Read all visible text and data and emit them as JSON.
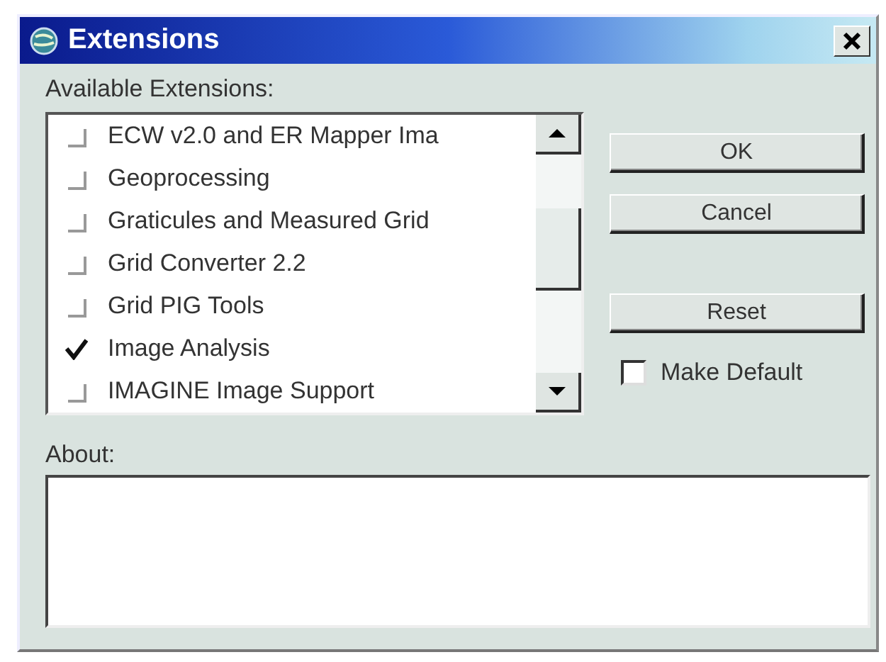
{
  "window": {
    "title": "Extensions"
  },
  "extensions": {
    "label": "Available Extensions:",
    "items": [
      {
        "label": "ECW v2.0 and ER Mapper Ima",
        "checked": false
      },
      {
        "label": "Geoprocessing",
        "checked": false
      },
      {
        "label": "Graticules and Measured Grid",
        "checked": false
      },
      {
        "label": "Grid Converter 2.2",
        "checked": false
      },
      {
        "label": "Grid PIG Tools",
        "checked": false
      },
      {
        "label": "Image Analysis",
        "checked": true
      },
      {
        "label": "IMAGINE Image Support",
        "checked": false
      }
    ]
  },
  "buttons": [
    "OK",
    "Cancel",
    "Reset"
  ],
  "make_default": {
    "label": "Make Default",
    "checked": false
  },
  "about": {
    "label": "About:"
  }
}
